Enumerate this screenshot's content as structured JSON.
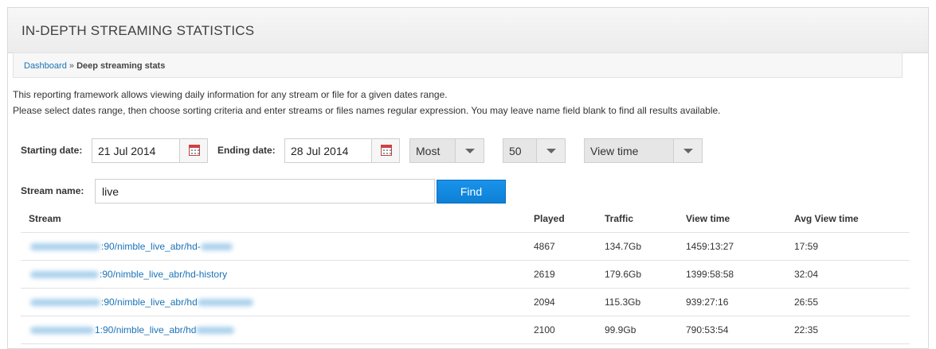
{
  "panel": {
    "title": "IN-DEPTH STREAMING STATISTICS"
  },
  "breadcrumb": {
    "link": "Dashboard",
    "separator": "»",
    "current": "Deep streaming stats"
  },
  "intro": {
    "line1": "This reporting framework allows viewing daily information for any stream or file for a given dates range.",
    "line2": "Please select dates range, then choose sorting criteria and enter streams or files names regular expression. You may leave name field blank to find all results available."
  },
  "filters": {
    "start_label": "Starting date:",
    "start_value": "21 Jul 2014",
    "end_label": "Ending date:",
    "end_value": "28 Jul 2014",
    "order_value": "Most",
    "limit_value": "50",
    "sort_value": "View time",
    "name_label": "Stream name:",
    "name_value": "live",
    "find_label": "Find"
  },
  "table": {
    "columns": [
      "Stream",
      "Played",
      "Traffic",
      "View time",
      "Avg View time"
    ],
    "rows": [
      {
        "stream_visible": ":90/nimble_live_abr/hd-",
        "played": "4867",
        "traffic": "134.7Gb",
        "view_time": "1459:13:27",
        "avg": "17:59"
      },
      {
        "stream_visible": ":90/nimble_live_abr/hd-history",
        "played": "2619",
        "traffic": "179.6Gb",
        "view_time": "1399:58:58",
        "avg": "32:04"
      },
      {
        "stream_visible": ":90/nimble_live_abr/hd",
        "played": "2094",
        "traffic": "115.3Gb",
        "view_time": "939:27:16",
        "avg": "26:55"
      },
      {
        "stream_visible": "1:90/nimble_live_abr/hd",
        "played": "2100",
        "traffic": "99.9Gb",
        "view_time": "790:53:54",
        "avg": "22:35"
      }
    ]
  },
  "colors": {
    "link": "#1a73b8",
    "primary_button": "#0c80d6",
    "redaction": "#9cc9e9"
  },
  "icons": {
    "date_picker": "calendar-icon",
    "dropdown": "chevron-down-icon"
  }
}
